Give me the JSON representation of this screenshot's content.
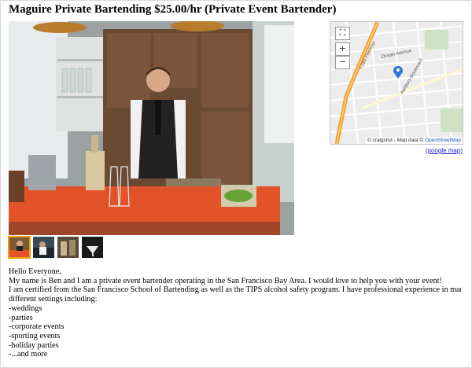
{
  "posting": {
    "title": "Maguire Private Bartending $25.00/hr (Private Event Bartender)"
  },
  "map": {
    "attribution_prefix": "© craigslist - Map data ©",
    "attribution_link": "OpenStreetMap",
    "google_link": "(google map)",
    "street_labels": [
      "Ocean Avenue",
      "Ashbury Boulevard",
      "I-280 Freeway"
    ],
    "controls": {
      "zoom_in": "+",
      "zoom_out": "−"
    }
  },
  "body": {
    "lines": [
      "Hello Everyone,",
      "My name is Ben and I am a private event bartender operating in the San Francisco Bay Area. I would love to help you with your event!",
      "I am certified from the San Francisco School of Bartending as well as the TIPS alcohol safety program. I have professional experience in many",
      "different settings including:",
      "-weddings",
      "-parties",
      "-corporate events",
      "-sporting events",
      "-holiday parties",
      "-...and more"
    ]
  },
  "colors": {
    "tablecloth": "#e2532a",
    "map_marker": "#2b7cd3",
    "freeway": "#f0a030",
    "thumb_selected": "#f0a000"
  }
}
